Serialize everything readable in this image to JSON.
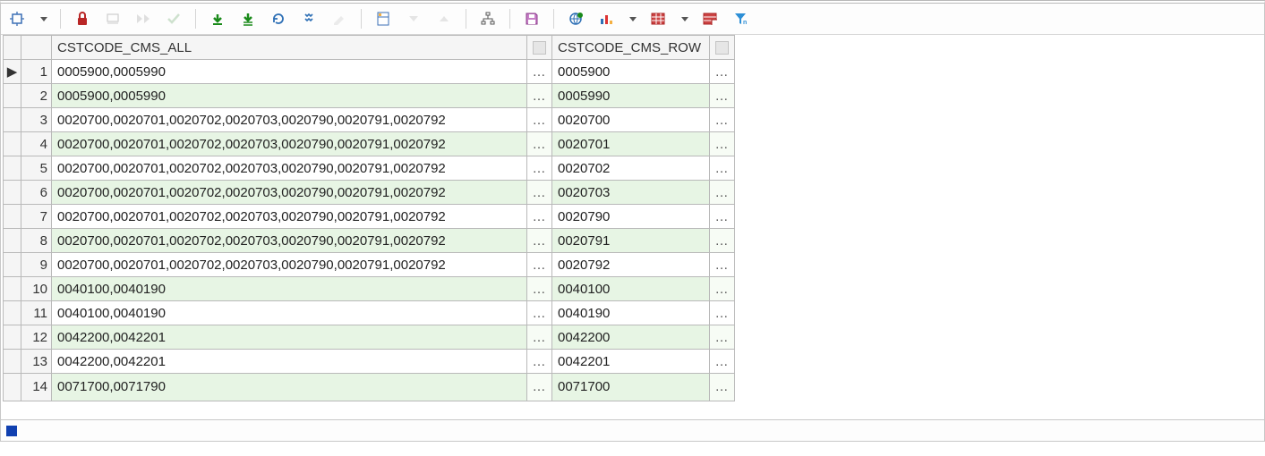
{
  "toolbar": {
    "icons": [
      "fit-window-icon",
      "dropdown-icon",
      "lock-icon",
      "eraser-icon",
      "goto-icon",
      "check-icon",
      "fetch-all-down-icon",
      "fetch-page-down-icon",
      "refresh-icon",
      "find-icon",
      "highlight-icon",
      "layout-icon",
      "down-triangle-icon",
      "up-triangle-icon",
      "hierarchy-icon",
      "save-icon",
      "globe-refresh-icon",
      "bar-chart-icon",
      "chart-dropdown-icon",
      "grid-view-icon",
      "grid-dropdown-icon",
      "report-icon",
      "filter-icon"
    ]
  },
  "grid": {
    "columns": [
      "CSTCODE_CMS_ALL",
      "CSTCODE_CMS_ROW"
    ],
    "ellipsis_label": "…",
    "current_row_marker": "▶",
    "rows": [
      {
        "n": 1,
        "all": "0005900,0005990",
        "row": "0005900",
        "alt": false,
        "marker": true
      },
      {
        "n": 2,
        "all": "0005900,0005990",
        "row": "0005990",
        "alt": true
      },
      {
        "n": 3,
        "all": "0020700,0020701,0020702,0020703,0020790,0020791,0020792",
        "row": "0020700",
        "alt": false
      },
      {
        "n": 4,
        "all": "0020700,0020701,0020702,0020703,0020790,0020791,0020792",
        "row": "0020701",
        "alt": true
      },
      {
        "n": 5,
        "all": "0020700,0020701,0020702,0020703,0020790,0020791,0020792",
        "row": "0020702",
        "alt": false
      },
      {
        "n": 6,
        "all": "0020700,0020701,0020702,0020703,0020790,0020791,0020792",
        "row": "0020703",
        "alt": true
      },
      {
        "n": 7,
        "all": "0020700,0020701,0020702,0020703,0020790,0020791,0020792",
        "row": "0020790",
        "alt": false
      },
      {
        "n": 8,
        "all": "0020700,0020701,0020702,0020703,0020790,0020791,0020792",
        "row": "0020791",
        "alt": true
      },
      {
        "n": 9,
        "all": "0020700,0020701,0020702,0020703,0020790,0020791,0020792",
        "row": "0020792",
        "alt": false
      },
      {
        "n": 10,
        "all": "0040100,0040190",
        "row": "0040100",
        "alt": true
      },
      {
        "n": 11,
        "all": "0040100,0040190",
        "row": "0040190",
        "alt": false
      },
      {
        "n": 12,
        "all": "0042200,0042201",
        "row": "0042200",
        "alt": true
      },
      {
        "n": 13,
        "all": "0042200,0042201",
        "row": "0042201",
        "alt": false
      },
      {
        "n": 14,
        "all": "0071700,0071790",
        "row": "0071700",
        "alt": true,
        "cutoff": true
      }
    ]
  }
}
